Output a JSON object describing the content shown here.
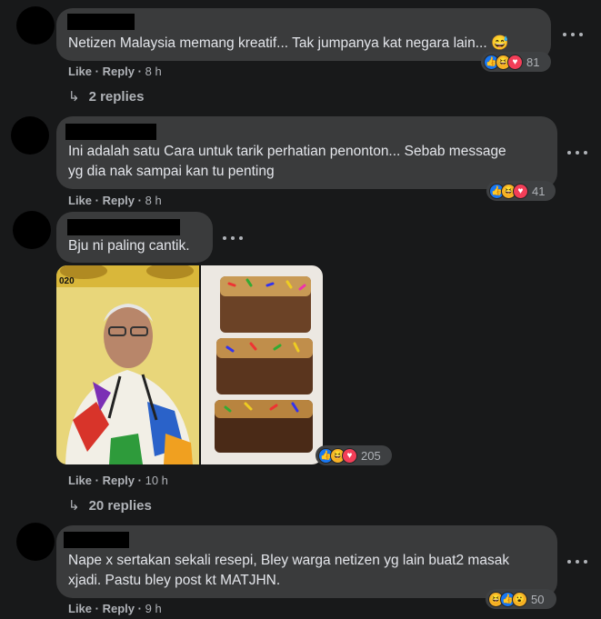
{
  "comments": [
    {
      "text_lines": [
        "Netizen Malaysia memang kreatif... Tak jumpanya kat negara lain... 😅"
      ],
      "actions": {
        "like": "Like",
        "reply": "Reply",
        "time": "8 h",
        "sep": "·"
      },
      "reaction_icons": [
        "like-icon",
        "haha-icon",
        "love-icon"
      ],
      "reaction_count": "81",
      "replies_label": "2 replies"
    },
    {
      "text_lines": [
        "Ini adalah satu Cara untuk tarik perhatian penonton... Sebab message",
        "yg dia nak sampai kan tu penting"
      ],
      "actions": {
        "like": "Like",
        "reply": "Reply",
        "time": "8 h",
        "sep": "·"
      },
      "reaction_icons": [
        "like-icon",
        "haha-icon",
        "love-icon"
      ],
      "reaction_count": "41"
    },
    {
      "text_lines": [
        "Bju ni paling cantik."
      ],
      "photo_label": "020",
      "actions": {
        "like": "Like",
        "reply": "Reply",
        "time": "10 h",
        "sep": "·"
      },
      "reaction_icons": [
        "like-icon",
        "haha-icon",
        "love-icon"
      ],
      "reaction_count": "205",
      "replies_label": "20 replies"
    },
    {
      "text_lines": [
        "Nape x sertakan sekali resepi, Bley warga netizen yg lain buat2 masak",
        "xjadi. Pastu bley post kt MATJHN."
      ],
      "actions": {
        "like": "Like",
        "reply": "Reply",
        "time": "9 h",
        "sep": "·"
      },
      "reaction_icons": [
        "haha-icon",
        "like-icon",
        "wow-icon"
      ],
      "reaction_count": "50"
    }
  ],
  "colors": {
    "background": "#18191a",
    "bubble": "#3a3b3c",
    "text": "#e4e6eb",
    "secondary": "#b0b3b8",
    "like": "#1877f2",
    "love": "#f33e58",
    "haha": "#f7b125"
  }
}
